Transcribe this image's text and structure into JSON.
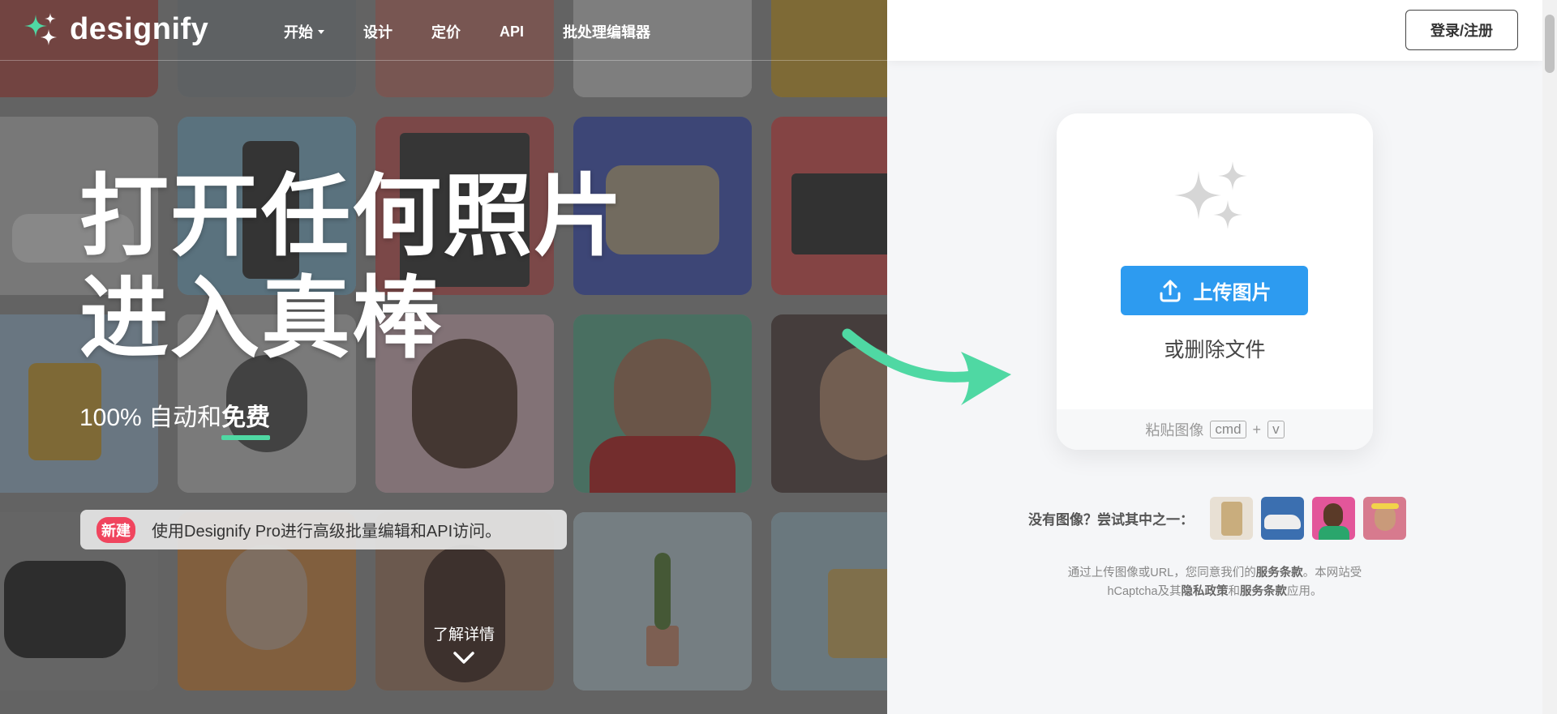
{
  "nav": {
    "logo_text": "designify",
    "links": [
      "开始",
      "设计",
      "定价",
      "API",
      "批处理编辑器"
    ]
  },
  "header": {
    "login_label": "登录/注册"
  },
  "hero": {
    "title_line1": "打开任何照片",
    "title_line2": "进入真棒",
    "sub_prefix": "100% 自动和",
    "sub_free": "免费",
    "promo_badge": "新建",
    "promo_text": "使用Designify Pro进行高级批量编辑和API访问。",
    "learn_more": "了解详情"
  },
  "upload": {
    "button_label": "上传图片",
    "drop_text": "或删除文件",
    "paste_label": "粘贴图像",
    "key_cmd": "cmd",
    "plus": "+",
    "key_v": "v"
  },
  "samples": {
    "label": "没有图像？尝试其中之一："
  },
  "terms": {
    "t1": "通过上传图像或URL，您同意我们的",
    "t2": "服务条款",
    "t3": "。本网站受hCaptcha及其",
    "t4": "隐私政策",
    "t5": "和",
    "t6": "服务条款",
    "t7": "应用。"
  },
  "colors": {
    "accent_green": "#4fd8a3",
    "upload_blue": "#2d9bf0",
    "badge_red": "#f0455e"
  }
}
